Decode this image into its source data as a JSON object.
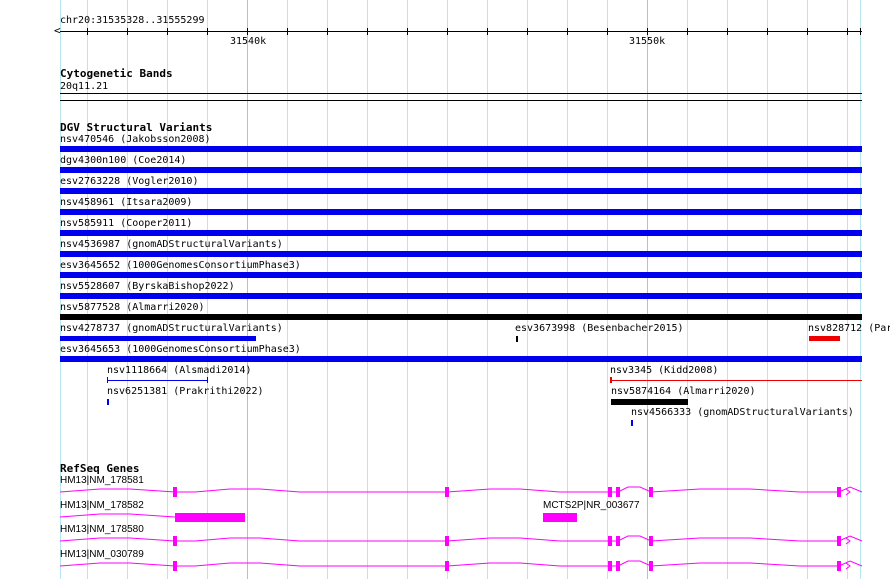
{
  "ruler": {
    "location": "chr20:31535328..31555299",
    "ticks": [
      "31540k",
      "31550k"
    ]
  },
  "cytobands": {
    "title": "Cytogenetic Bands",
    "band": "20q11.21"
  },
  "dgv": {
    "title": "DGV Structural Variants",
    "items": [
      "nsv470546 (Jakobsson2008)",
      "dgv4300n100 (Coe2014)",
      "esv2763228 (Vogler2010)",
      "nsv458961 (Itsara2009)",
      "nsv585911 (Cooper2011)",
      "nsv4536987 (gnomADStructuralVariants)",
      "esv3645652 (1000GenomesConsortiumPhase3)",
      "nsv5528607 (ByrskaBishop2022)",
      "nsv5877528 (Almarri2020)",
      "nsv4278737 (gnomADStructuralVariants)",
      "esv3673998 (Besenbacher2015)",
      "nsv828712 (Par",
      "esv3645653 (1000GenomesConsortiumPhase3)",
      "nsv1118664 (Alsmadi2014)",
      "nsv3345 (Kidd2008)",
      "nsv6251381 (Prakrithi2022)",
      "nsv5874164 (Almarri2020)",
      "nsv4566333 (gnomADStructuralVariants)"
    ]
  },
  "genes": {
    "title": "RefSeq Genes",
    "items": [
      "HM13|NM_178581",
      "HM13|NM_178582",
      "MCTS2P|NR_003677",
      "HM13|NM_178580",
      "HM13|NM_030789"
    ]
  },
  "colors": {
    "blue": "#0000ee",
    "black": "#000000",
    "red": "#ee0000",
    "magenta": "#ff00ff"
  }
}
